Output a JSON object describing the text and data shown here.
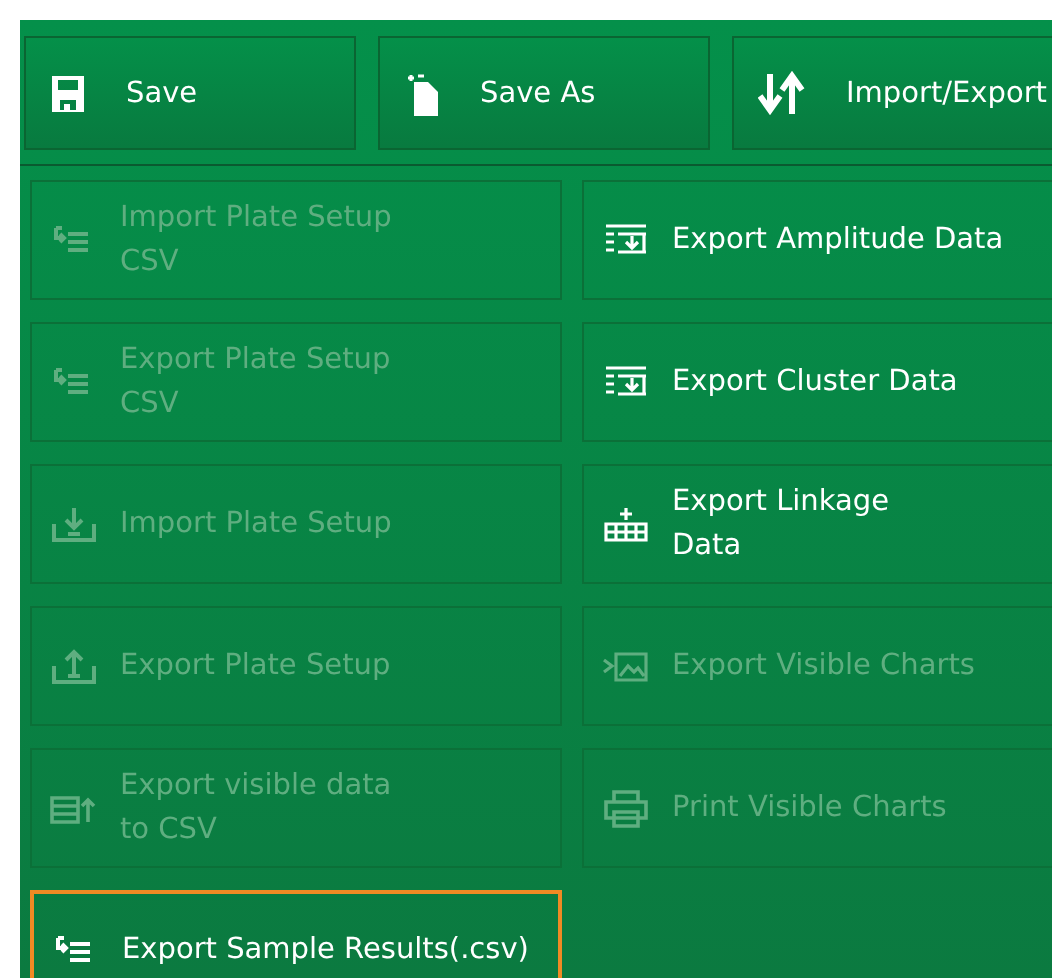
{
  "toolbar": [
    {
      "label": "Save"
    },
    {
      "label": "Save As"
    },
    {
      "label": "Import/Export"
    }
  ],
  "actions": [
    {
      "label": "Import Plate Setup\nCSV",
      "disabled": true,
      "focused": false
    },
    {
      "label": "Export Plate Setup\nCSV",
      "disabled": true,
      "focused": false
    },
    {
      "label": "Import Plate Setup",
      "disabled": true,
      "focused": false
    },
    {
      "label": "Export Plate Setup",
      "disabled": true,
      "focused": false
    },
    {
      "label": "Export visible data\nto CSV",
      "disabled": true,
      "focused": false
    },
    {
      "label": "Export Sample Results(.csv)",
      "disabled": false,
      "focused": true
    },
    {
      "label": "Export Amplitude Data",
      "disabled": false,
      "focused": false
    },
    {
      "label": "Export Cluster Data",
      "disabled": false,
      "focused": false
    },
    {
      "label": "Export Linkage\nData",
      "disabled": false,
      "focused": false
    },
    {
      "label": "Export Visible Charts",
      "disabled": true,
      "focused": false
    },
    {
      "label": "Print Visible Charts",
      "disabled": true,
      "focused": false
    }
  ]
}
